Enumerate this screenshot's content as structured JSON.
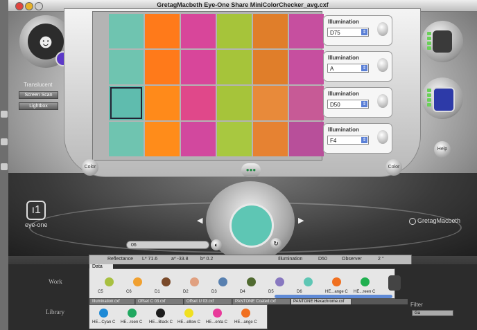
{
  "window": {
    "title": "GretagMacbeth Eye-One Share   MiniColorChecker_avg.cxf"
  },
  "sidebar": {
    "translucent_label": "Translucent",
    "btn_screen": "Screen Scan",
    "btn_lightbox": "Lightbox"
  },
  "patches": [
    [
      "#6fc4b0",
      "#ff7a1a",
      "#d8469a",
      "#a6c43a",
      "#e07e2a",
      "#c64f9f"
    ],
    [
      "#6fc4b0",
      "#ff7a1a",
      "#d8469a",
      "#a6c43a",
      "#e07e2a",
      "#c64f9f"
    ],
    [
      "#5fbcae",
      "#ff8a1a",
      "#e0488a",
      "#a6c43a",
      "#e88a3a",
      "#c75a96"
    ],
    [
      "#6fc4b0",
      "#ff8c1a",
      "#d2489e",
      "#a8c840",
      "#e68232",
      "#b84f9a"
    ]
  ],
  "illuminations": [
    {
      "label": "Illumination",
      "value": "D75"
    },
    {
      "label": "Illumination",
      "value": "A"
    },
    {
      "label": "Illumination",
      "value": "D50"
    },
    {
      "label": "Illumination",
      "value": "F4"
    }
  ],
  "buttons": {
    "left_round": "Color",
    "right_round": "Color",
    "help": "Help"
  },
  "sample": {
    "name": "06",
    "color": "#5ec6b4"
  },
  "measurement": {
    "mode": "Reflectance",
    "l": "L* 71.6",
    "a": "a* -33.8",
    "b": "b* 0.2",
    "illum_label": "Illumination",
    "illum_value": "D50",
    "observer_label": "Observer",
    "observer_value": "2 °"
  },
  "logos": {
    "left": "eye-one",
    "right": "GretagMacbeth"
  },
  "work": {
    "label": "Work",
    "tab": "Data",
    "swatches": [
      {
        "color": "#a8c040",
        "name": "C5"
      },
      {
        "color": "#f0a030",
        "name": "C6"
      },
      {
        "color": "#7a4a2a",
        "name": "D1"
      },
      {
        "color": "#e0a080",
        "name": "D2"
      },
      {
        "color": "#5880b0",
        "name": "D3"
      },
      {
        "color": "#506a30",
        "name": "D4"
      },
      {
        "color": "#8878c0",
        "name": "D5"
      },
      {
        "color": "#5ec6b4",
        "name": "D6"
      },
      {
        "color": "#f07020",
        "name": "HE...ange C"
      },
      {
        "color": "#20b050",
        "name": "HE...reen C"
      }
    ]
  },
  "library": {
    "label": "Library",
    "tabs": [
      "Illumination.cxf",
      "Offset C 03.cxf",
      "Offset U 03.cxf",
      "PANTONE Coated.cxf",
      "PANTONE Hexachrome.cxf"
    ],
    "swatches": [
      {
        "color": "#1e8ad6",
        "name": "HE...Cyan C"
      },
      {
        "color": "#20a860",
        "name": "HE...reen C"
      },
      {
        "color": "#1c1c1c",
        "name": "HE...Black C"
      },
      {
        "color": "#f0e020",
        "name": "HE...ellow C"
      },
      {
        "color": "#e83a9a",
        "name": "HE...enta C"
      },
      {
        "color": "#f07020",
        "name": "HE...ange C"
      }
    ],
    "filter_label": "Filter",
    "filter_value": "Ga"
  }
}
